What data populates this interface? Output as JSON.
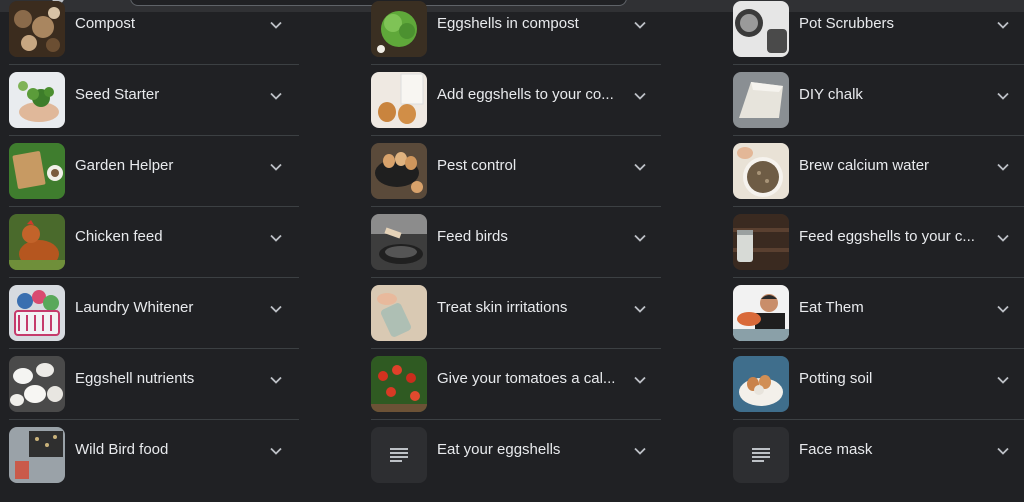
{
  "columns": [
    {
      "items": [
        {
          "label": "Compost",
          "thumb": "compost-photo-icon"
        },
        {
          "label": "Seed Starter",
          "thumb": "seedling-photo-icon"
        },
        {
          "label": "Garden Helper",
          "thumb": "garden-photo-icon"
        },
        {
          "label": "Chicken feed",
          "thumb": "chicken-photo-icon"
        },
        {
          "label": "Laundry Whitener",
          "thumb": "laundry-photo-icon"
        },
        {
          "label": "Eggshell nutrients",
          "thumb": "eggshells-photo-icon"
        },
        {
          "label": "Wild Bird food",
          "thumb": "bird-food-photo-icon"
        }
      ]
    },
    {
      "items": [
        {
          "label": "Eggshells in compost",
          "thumb": "lettuce-photo-icon"
        },
        {
          "label": "Add eggshells to your co...",
          "thumb": "eggs-photo-icon"
        },
        {
          "label": "Pest control",
          "thumb": "eggs-bowl-photo-icon"
        },
        {
          "label": "Feed birds",
          "thumb": "pan-photo-icon"
        },
        {
          "label": "Treat skin irritations",
          "thumb": "jar-photo-icon"
        },
        {
          "label": "Give your tomatoes a cal...",
          "thumb": "tomatoes-photo-icon"
        },
        {
          "label": "Eat your eggshells",
          "thumb": "text-lines-icon"
        }
      ]
    },
    {
      "items": [
        {
          "label": "Pot Scrubbers",
          "thumb": "pot-photo-icon"
        },
        {
          "label": "DIY chalk",
          "thumb": "chalk-photo-icon"
        },
        {
          "label": "Brew calcium water",
          "thumb": "calcium-bowl-photo-icon"
        },
        {
          "label": "Feed eggshells to your c...",
          "thumb": "glass-jar-photo-icon"
        },
        {
          "label": "Eat Them",
          "thumb": "man-eating-photo-icon"
        },
        {
          "label": "Potting soil",
          "thumb": "bowl-eggs-photo-icon"
        },
        {
          "label": "Face mask",
          "thumb": "text-lines-icon"
        }
      ]
    }
  ],
  "colors": {
    "background": "#202124",
    "text": "#e8eaed",
    "divider": "#3c4043",
    "chevron": "#bdc1c6"
  }
}
